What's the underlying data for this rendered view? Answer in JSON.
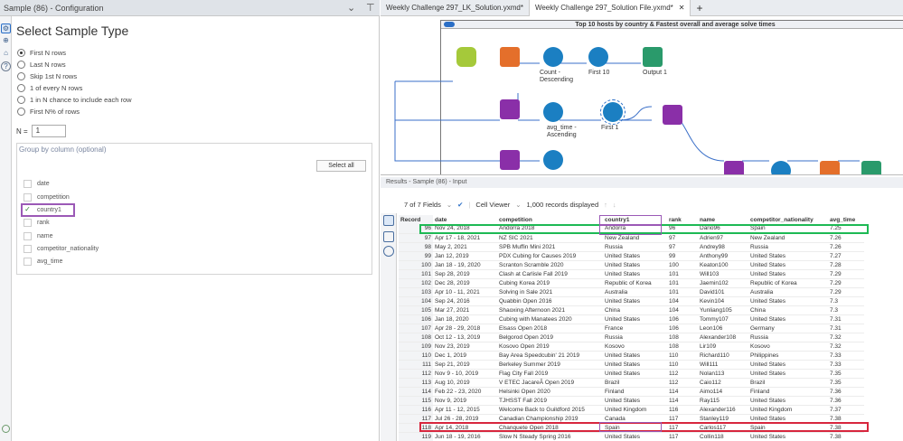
{
  "config": {
    "header": "Sample (86) - Configuration",
    "title": "Select Sample Type",
    "options": [
      {
        "label": "First N rows",
        "selected": true
      },
      {
        "label": "Last N rows",
        "selected": false
      },
      {
        "label": "Skip 1st N rows",
        "selected": false
      },
      {
        "label": "1 of every N rows",
        "selected": false
      },
      {
        "label": "1 in N chance to include each row",
        "selected": false
      },
      {
        "label": "First N% of rows",
        "selected": false
      }
    ],
    "n_label": "N =",
    "n_value": "1",
    "group_label": "Group by column (optional)",
    "select_all": "Select all",
    "columns": [
      {
        "name": "date",
        "checked": false
      },
      {
        "name": "competition",
        "checked": false
      },
      {
        "name": "country1",
        "checked": true
      },
      {
        "name": "rank",
        "checked": false
      },
      {
        "name": "name",
        "checked": false
      },
      {
        "name": "competitor_nationality",
        "checked": false
      },
      {
        "name": "avg_time",
        "checked": false
      }
    ]
  },
  "tabs": [
    {
      "label": "Weekly Challenge 297_LK_Solution.yxmd*",
      "active": false
    },
    {
      "label": "Weekly Challenge 297_Solution File.yxmd*",
      "active": true
    }
  ],
  "canvas": {
    "container_title": "Top 10 hosts by country & Fastest overall and average solve times",
    "labels": [
      "Count - Descending",
      "First 10",
      "Output 1",
      "avg_time - Ascending",
      "First 1"
    ]
  },
  "results": {
    "header": "Results - Sample (86) - Input",
    "fields": "7 of 7 Fields",
    "viewer": "Cell Viewer",
    "records": "1,000 records displayed",
    "columns": [
      "Record",
      "date",
      "competition",
      "country1",
      "rank",
      "name",
      "competitor_nationality",
      "avg_time"
    ],
    "rows": [
      [
        "96",
        "Nov 24, 2018",
        "Andorra 2018",
        "Andorra",
        "96",
        "Dario96",
        "Spain",
        "7.25"
      ],
      [
        "97",
        "Apr 17 - 18, 2021",
        "NZ SIC 2021",
        "New Zealand",
        "97",
        "Adrien97",
        "New Zealand",
        "7.26"
      ],
      [
        "98",
        "May 2, 2021",
        "SPB Muffin Mini 2021",
        "Russia",
        "97",
        "Andrey98",
        "Russia",
        "7.26"
      ],
      [
        "99",
        "Jan 12, 2019",
        "PDX Cubing for Causes 2019",
        "United States",
        "99",
        "Anthony99",
        "United States",
        "7.27"
      ],
      [
        "100",
        "Jan 18 - 19, 2020",
        "Scranton Scramble 2020",
        "United States",
        "100",
        "Keaton100",
        "United States",
        "7.28"
      ],
      [
        "101",
        "Sep 28, 2019",
        "Clash at Carlisle Fall 2019",
        "United States",
        "101",
        "Will103",
        "United States",
        "7.29"
      ],
      [
        "102",
        "Dec 28, 2019",
        "Cubing Korea 2019",
        "Republic of Korea",
        "101",
        "Jaemin102",
        "Republic of Korea",
        "7.29"
      ],
      [
        "103",
        "Apr 10 - 11, 2021",
        "Solving in Sale 2021",
        "Australia",
        "101",
        "David101",
        "Australia",
        "7.29"
      ],
      [
        "104",
        "Sep 24, 2016",
        "Quabbin Open 2016",
        "United States",
        "104",
        "Kevin104",
        "United States",
        "7.3"
      ],
      [
        "105",
        "Mar 27, 2021",
        "Shaoxing Afternoon 2021",
        "China",
        "104",
        "Yunliang105",
        "China",
        "7.3"
      ],
      [
        "106",
        "Jan 18, 2020",
        "Cubing with Manatees 2020",
        "United States",
        "106",
        "Tommy107",
        "United States",
        "7.31"
      ],
      [
        "107",
        "Apr 28 - 29, 2018",
        "Elsass Open 2018",
        "France",
        "106",
        "Leon106",
        "Germany",
        "7.31"
      ],
      [
        "108",
        "Oct 12 - 13, 2019",
        "Belgorod Open 2019",
        "Russia",
        "108",
        "Alexander108",
        "Russia",
        "7.32"
      ],
      [
        "109",
        "Nov 23, 2019",
        "Kosovo Open 2019",
        "Kosovo",
        "108",
        "Lir109",
        "Kosovo",
        "7.32"
      ],
      [
        "110",
        "Dec 1, 2019",
        "Bay Area Speedcubin' 21 2019",
        "United States",
        "110",
        "Richard110",
        "Philippines",
        "7.33"
      ],
      [
        "111",
        "Sep 21, 2019",
        "Berkeley Summer 2019",
        "United States",
        "110",
        "Will111",
        "United States",
        "7.33"
      ],
      [
        "112",
        "Nov 9 - 10, 2019",
        "Flag City Fall 2019",
        "United States",
        "112",
        "Nolan113",
        "United States",
        "7.35"
      ],
      [
        "113",
        "Aug 10, 2019",
        "V ETEC JacareÃ Open 2019",
        "Brazil",
        "112",
        "Caio112",
        "Brazil",
        "7.35"
      ],
      [
        "114",
        "Feb 22 - 23, 2020",
        "Helsinki Open 2020",
        "Finland",
        "114",
        "Aimo114",
        "Finland",
        "7.36"
      ],
      [
        "115",
        "Nov 9, 2019",
        "TJHSST Fall 2019",
        "United States",
        "114",
        "Ray115",
        "United States",
        "7.36"
      ],
      [
        "116",
        "Apr 11 - 12, 2015",
        "Welcome Back to Guildford 2015",
        "United Kingdom",
        "116",
        "Alexander116",
        "United Kingdom",
        "7.37"
      ],
      [
        "117",
        "Jul 26 - 28, 2019",
        "Canadian Championship 2019",
        "Canada",
        "117",
        "Stanley119",
        "United States",
        "7.38"
      ],
      [
        "118",
        "Apr 14, 2018",
        "Chanquete Open 2018",
        "Spain",
        "117",
        "Carlos117",
        "Spain",
        "7.38"
      ],
      [
        "119",
        "Jun 18 - 19, 2016",
        "Slow N Steady Spring 2016",
        "United States",
        "117",
        "Collin118",
        "United States",
        "7.38"
      ]
    ]
  },
  "colors": {
    "green_highlight": "#1db954",
    "red_highlight": "#d7263d",
    "purple_highlight": "#9b59b6"
  }
}
